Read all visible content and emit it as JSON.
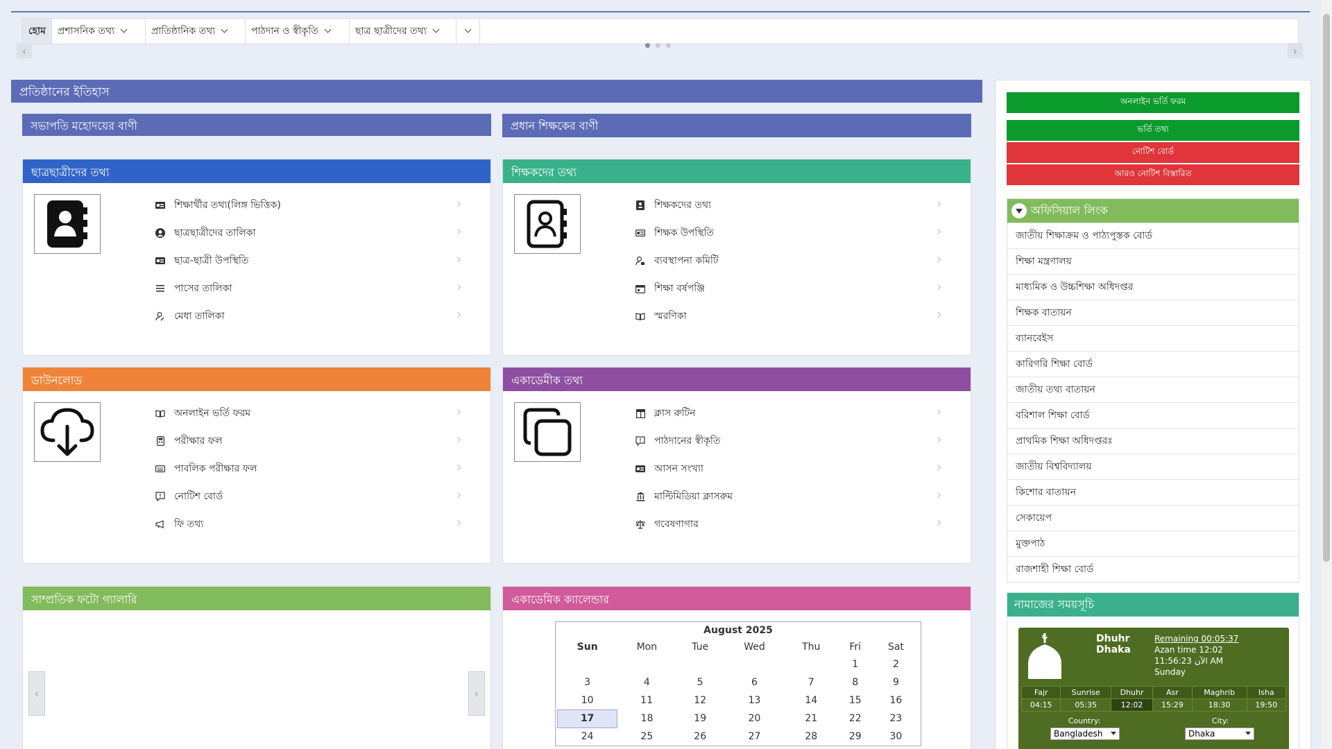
{
  "menu": {
    "home": "হোম",
    "items": [
      "প্রশাসনিক তথ্য",
      "প্রাতিষ্ঠানিক তথ্য",
      "পাঠদান ও স্বীকৃতি",
      "ছাত্র ছাত্রীদের তথ্য"
    ]
  },
  "history_title": "প্রতিষ্ঠানের ইতিহাস",
  "chairman_msg": "সভাপতি মহোদয়ের বাণী",
  "head_msg": "প্রধান শিক্ষকের বাণী",
  "panels": {
    "students": {
      "title": "ছাত্রছাত্রীদের তথ্য",
      "color": "#2f63c8",
      "icon": "contact-book-icon",
      "items": [
        "শিক্ষার্থীর তথ্য(লিঙ্গ ভিত্তিক)",
        "ছাত্রছাত্রীদের তালিকা",
        "ছাত্র-ছাত্রী উপস্থিতি",
        "পাসের তালিকা",
        "মেধা তালিকা"
      ]
    },
    "teachers": {
      "title": "শিক্ষকদের তথ্য",
      "color": "#3ab18a",
      "icon": "contact-book-icon",
      "items": [
        "শিক্ষকদের তথ্য",
        "শিক্ষক উপস্থিতি",
        "ব্যবস্থাপনা কমিটি",
        "শিক্ষা বর্ষপঞ্জি",
        "স্মরণিকা"
      ]
    },
    "download": {
      "title": "ডাউনলোড",
      "color": "#ef8438",
      "icon": "cloud-download-icon",
      "items": [
        "অনলাইন ভর্তি ফরম",
        "পরীক্ষার ফল",
        "পাবলিক পরীক্ষার ফল",
        "নোটিশ বোর্ড",
        "ফি তথ্য"
      ]
    },
    "academic": {
      "title": "একাডেমীক তথ্য",
      "color": "#8e4fa0",
      "icon": "copy-icon",
      "items": [
        "ক্লাস রুটিন",
        "পাঠদানের স্বীকৃতি",
        "আসন সংখ্যা",
        "মাল্টিমিডিয়া ক্লাসরুম",
        "গবেষণাগার"
      ]
    }
  },
  "gallery_title": "সাম্প্রতিক ফটো গ্যালারি",
  "calendar": {
    "title": "একাডেমিক ক্যালেন্ডার",
    "month": "August 2025",
    "weekdays": [
      "Sun",
      "Mon",
      "Tue",
      "Wed",
      "Thu",
      "Fri",
      "Sat"
    ],
    "weeks": [
      [
        "",
        "",
        "",
        "",
        "",
        "1",
        "2"
      ],
      [
        "3",
        "4",
        "5",
        "6",
        "7",
        "8",
        "9"
      ],
      [
        "10",
        "11",
        "12",
        "13",
        "14",
        "15",
        "16"
      ],
      [
        "17",
        "18",
        "19",
        "20",
        "21",
        "22",
        "23"
      ],
      [
        "24",
        "25",
        "26",
        "27",
        "28",
        "29",
        "30"
      ]
    ],
    "today": "17"
  },
  "sidebar": {
    "buttons": [
      {
        "label": "অনলাইন ভর্তি ফরম",
        "color": "#0b9a2c"
      },
      {
        "label": "ভর্তি তথ্য",
        "color": "#0b9a2c"
      },
      {
        "label": "নোটিশ বোর্ড",
        "color": "#e0353a"
      },
      {
        "label": "আরও নোটিশ বিস্তারিত",
        "color": "#e0353a"
      }
    ],
    "links_title": "অফিসিয়াল লিংক",
    "links": [
      "জাতীয় শিক্ষাক্রম ও পাঠ্যপুস্তক বোর্ড",
      "শিক্ষা মন্ত্রণালয়",
      "মাধ্যমিক ও উচ্চশিক্ষা অধিদপ্তর",
      "শিক্ষক বাতায়ন",
      "ব্যানবেইস",
      "কারিগরি শিক্ষা বোর্ড",
      "জাতীয় তথ্য বাতায়ন",
      "বরিশাল শিক্ষা বোর্ড",
      "প্রাথমিক শিক্ষা অধিদপ্তরঃ",
      "জাতীয় বিশ্ববিদ্যালয়",
      "কিশোর বাতায়ন",
      "সেকায়েপ",
      "মুক্তপাঠ",
      "রাজশাহী শিক্ষা বোর্ড"
    ],
    "prayer_title": "নামাজের সময়সূচি"
  },
  "prayer": {
    "name": "Dhuhr",
    "city_name": "Dhaka",
    "remaining": "Remaining 00:05:37",
    "azan": "Azan time 12:02",
    "clock": "11:56:23 الآن AM",
    "day": "Sunday",
    "names": [
      "Fajr",
      "Sunrise",
      "Dhuhr",
      "Asr",
      "Maghrib",
      "Isha"
    ],
    "times": [
      "04:15",
      "05:35",
      "12:02",
      "15:29",
      "18:30",
      "19:50"
    ],
    "country_label": "Country:",
    "city_label": "City:",
    "country": "Bangladesh",
    "city": "Dhaka"
  }
}
